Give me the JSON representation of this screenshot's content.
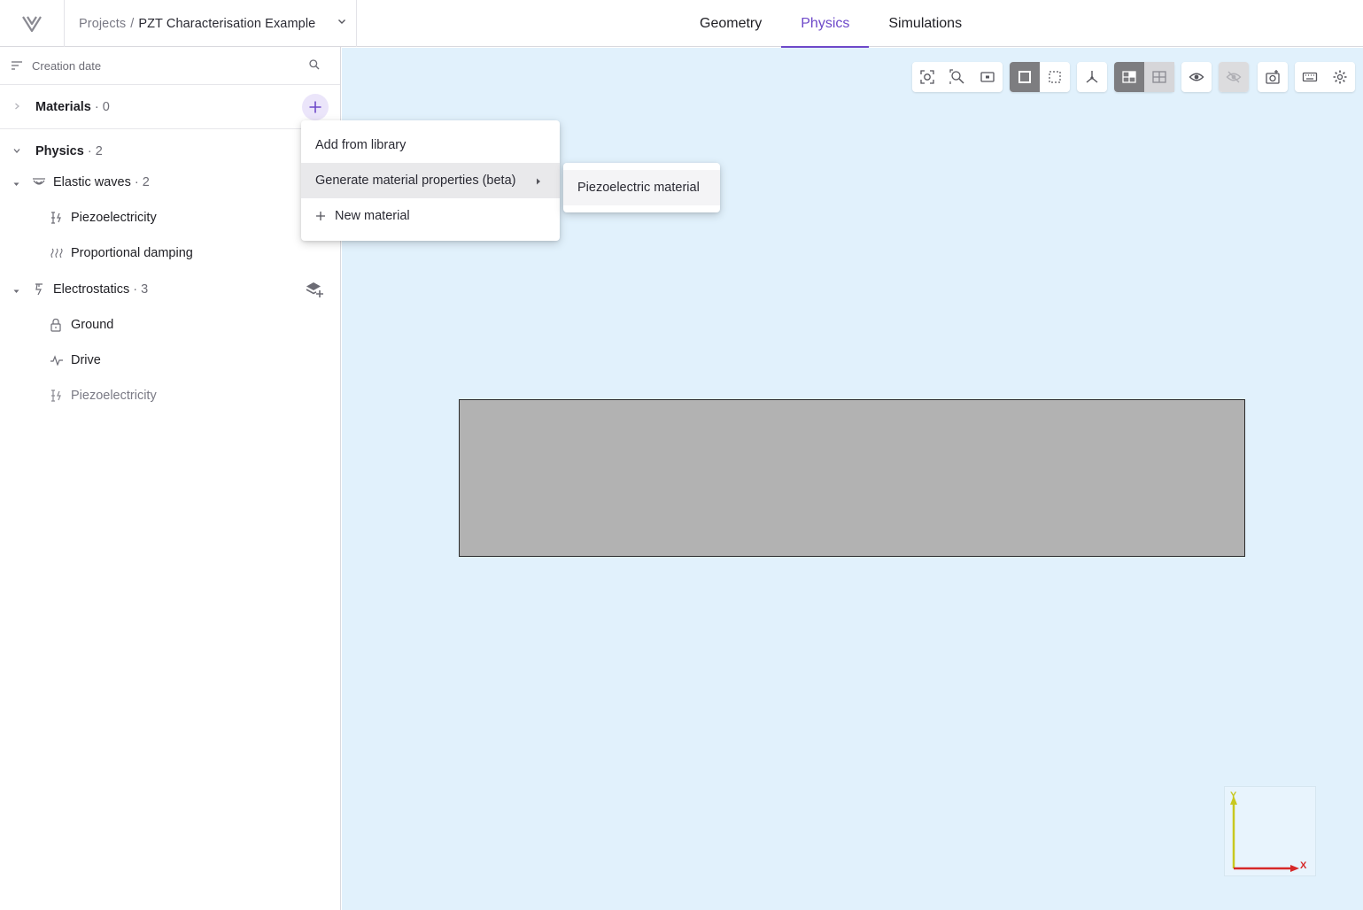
{
  "header": {
    "breadcrumb_root": "Projects",
    "breadcrumb_separator": "/",
    "project_name": "PZT Characterisation Example",
    "tabs": [
      {
        "label": "Geometry",
        "active": false
      },
      {
        "label": "Physics",
        "active": true
      },
      {
        "label": "Simulations",
        "active": false
      }
    ],
    "accent_color": "#6e49c9"
  },
  "sidebar": {
    "sort_label": "Creation date",
    "materials": {
      "title": "Materials",
      "separator": "·",
      "count": "0"
    },
    "physics": {
      "title": "Physics",
      "separator": "·",
      "count": "2"
    },
    "tree": {
      "elastic_waves": {
        "label": "Elastic waves",
        "separator": "·",
        "count": "2"
      },
      "elastic_piezo": {
        "label": "Piezoelectricity"
      },
      "proportional_damping": {
        "label": "Proportional damping"
      },
      "electrostatics": {
        "label": "Electrostatics",
        "separator": "·",
        "count": "3"
      },
      "ground": {
        "label": "Ground"
      },
      "drive": {
        "label": "Drive"
      },
      "electro_piezo": {
        "label": "Piezoelectricity"
      }
    }
  },
  "menu": {
    "items": [
      {
        "label": "Add from library"
      },
      {
        "label": "Generate material properties (beta)"
      },
      {
        "label": "New material"
      }
    ],
    "submenu": [
      {
        "label": "Piezoelectric material"
      }
    ]
  },
  "viewport": {
    "background_color": "#e1f1fc",
    "shape_color": "#b2b2b2",
    "axes": {
      "x_label": "X",
      "y_label": "Y",
      "x_color": "#d62828",
      "y_color": "#d8d820"
    },
    "toolbar_icons": [
      "zoom-fit-icon",
      "zoom-region-icon",
      "zoom-box-icon",
      "solid-view-icon",
      "wireframe-view-icon",
      "axis-orientation-icon",
      "section-view-icon",
      "grid-view-icon",
      "show-icon",
      "hide-icon",
      "screenshot-icon",
      "keyboard-icon",
      "settings-icon"
    ]
  }
}
